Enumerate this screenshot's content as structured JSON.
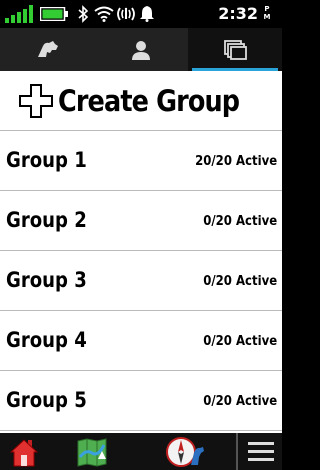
{
  "status_bar": {
    "time": "2:32",
    "ampm_top": "P",
    "ampm_bottom": "M",
    "icons": [
      "signal-icon",
      "battery-icon",
      "bluetooth-icon",
      "wifi-icon",
      "nfc-icon",
      "notification-bell-icon"
    ],
    "battery_level": 1.0
  },
  "tabs": [
    {
      "icon": "dog-icon",
      "active": false
    },
    {
      "icon": "person-icon",
      "active": false
    },
    {
      "icon": "groups-icon",
      "active": true
    }
  ],
  "create_group": {
    "label": "Create Group",
    "icon": "plus-icon"
  },
  "groups": [
    {
      "name": "Group 1",
      "status": "20/20 Active"
    },
    {
      "name": "Group 2",
      "status": "0/20 Active"
    },
    {
      "name": "Group 3",
      "status": "0/20 Active"
    },
    {
      "name": "Group 4",
      "status": "0/20 Active"
    },
    {
      "name": "Group 5",
      "status": "0/20 Active"
    }
  ],
  "bottom_bar": {
    "icons": [
      "home-icon",
      "map-icon",
      "compass-dog-icon",
      "menu-icon"
    ]
  },
  "colors": {
    "accent": "#2aa3d8",
    "battery": "#33cc33",
    "signal": "#33cc33"
  }
}
